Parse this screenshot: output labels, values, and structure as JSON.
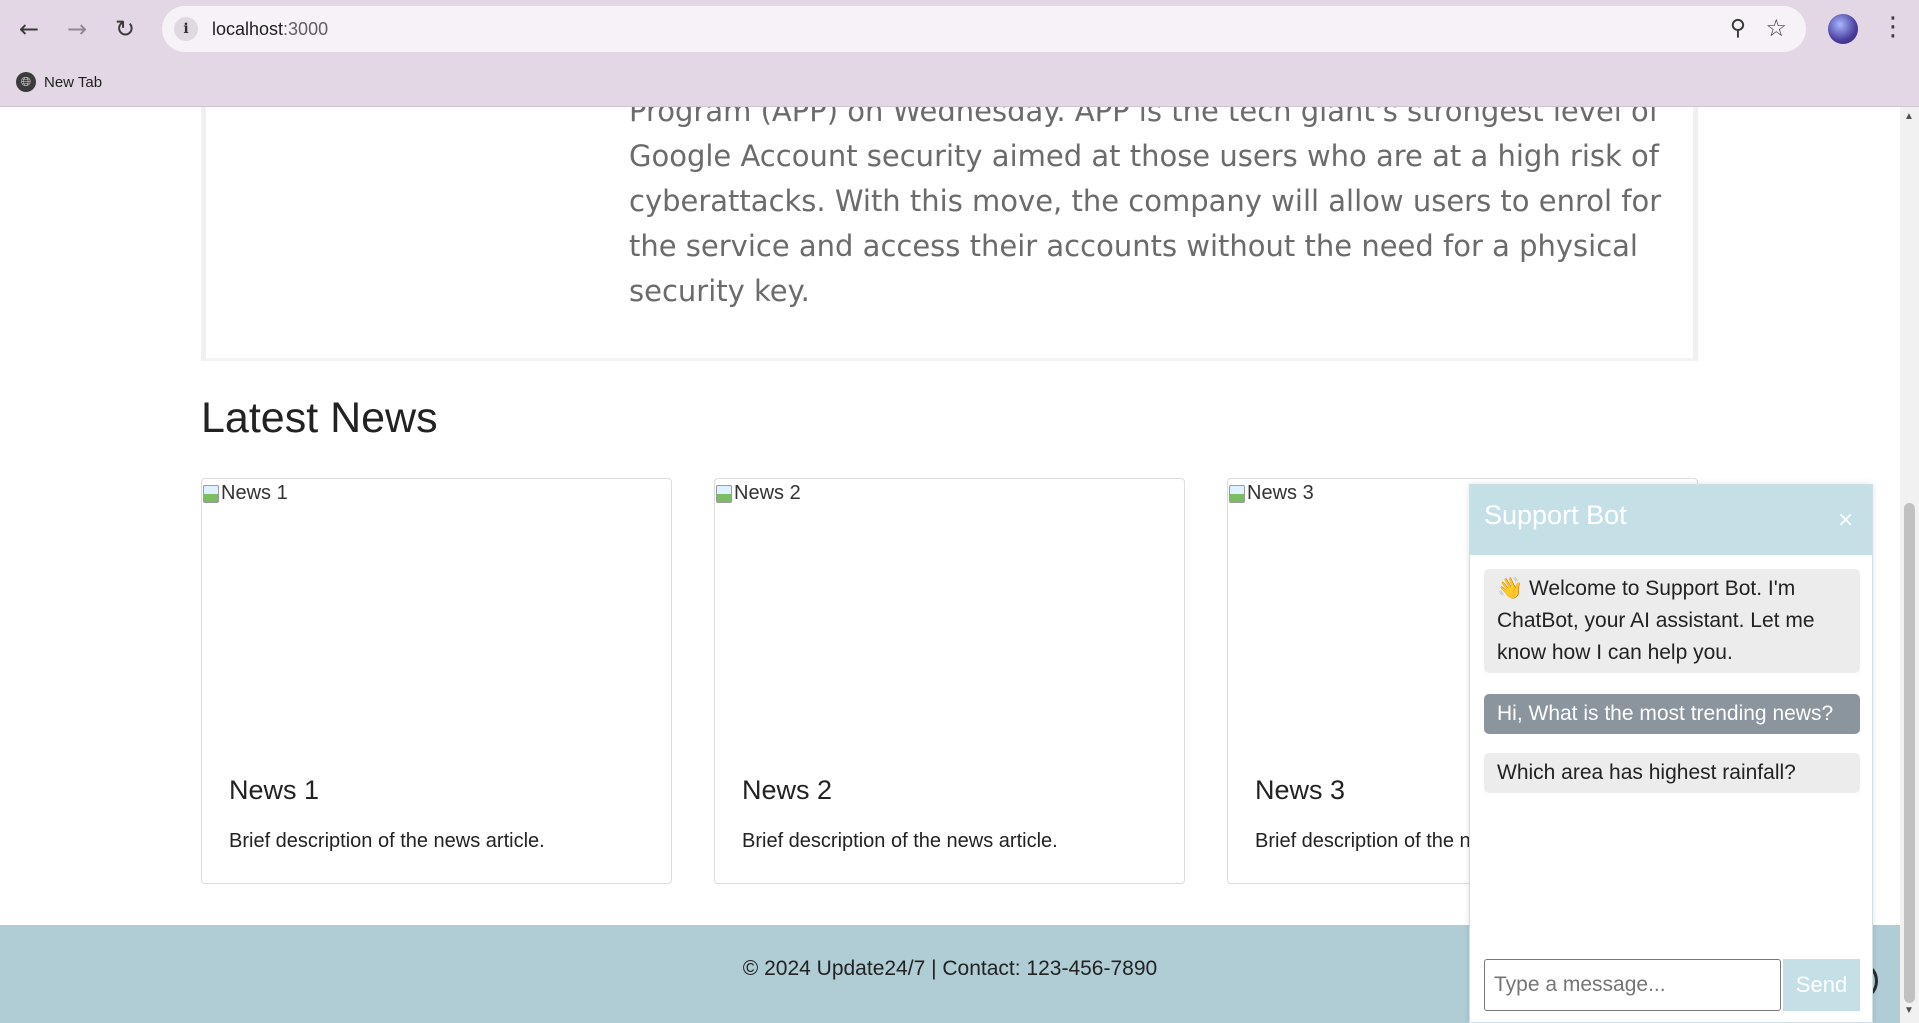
{
  "browser": {
    "url_host": "localhost",
    "url_port": ":3000",
    "bookmark_label": "New Tab"
  },
  "article": {
    "text": "Program (APP) on Wednesday. APP is the tech giant's strongest level of Google Account security aimed at those users who are at a high risk of cyberattacks. With this move, the company will allow users to enrol for the service and access their accounts without the need for a physical security key."
  },
  "latest_news": {
    "title": "Latest News",
    "cards": [
      {
        "img_alt": "News 1",
        "title": "News 1",
        "description": "Brief description of the news article."
      },
      {
        "img_alt": "News 2",
        "title": "News 2",
        "description": "Brief description of the news article."
      },
      {
        "img_alt": "News 3",
        "title": "News 3",
        "description": "Brief description of the news article."
      }
    ]
  },
  "footer": {
    "text": "© 2024 Update24/7 | Contact: 123-456-7890"
  },
  "chatbot": {
    "title": "Support Bot",
    "close_label": "×",
    "messages": [
      {
        "from": "bot",
        "text": "👋 Welcome to Support Bot. I'm ChatBot, your AI assistant. Let me know how I can help you."
      },
      {
        "from": "user",
        "text": "Hi, What is the most trending news?"
      },
      {
        "from": "bot",
        "text": "Which area has highest rainfall?"
      }
    ],
    "input_placeholder": "Type a message...",
    "send_label": "Send"
  },
  "colors": {
    "chrome": "#e3d7e5",
    "footer": "#b0cdd6",
    "chat_header": "#c4dfe6",
    "user_bubble": "#8b959e"
  }
}
